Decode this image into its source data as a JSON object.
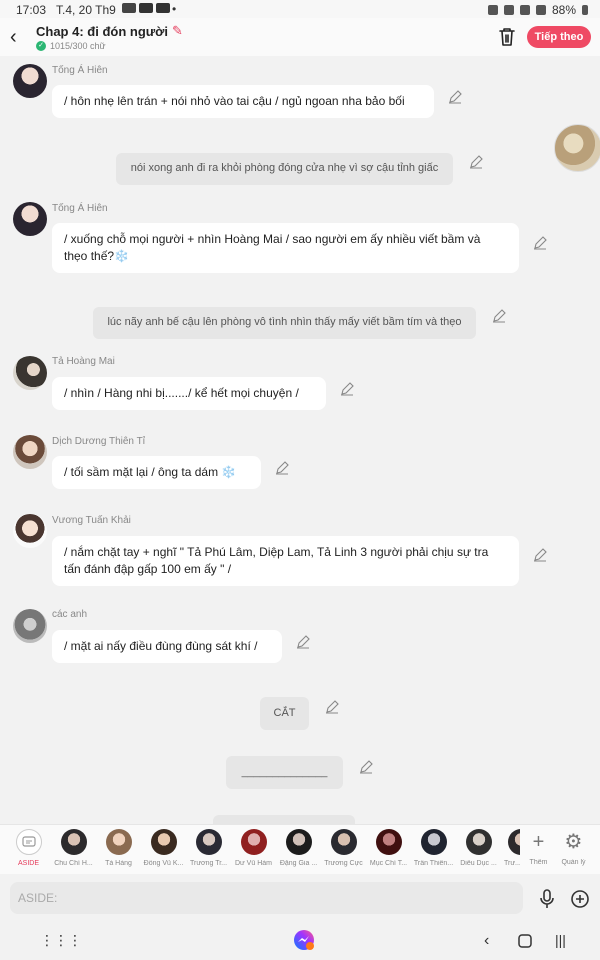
{
  "status": {
    "time": "17:03",
    "date": "T.4, 20 Th9",
    "dot": "•",
    "battery": "88%",
    "icon_names": [
      "app-icon",
      "youtube-icon",
      "youtube-icon",
      "lock-icon",
      "mute-icon",
      "wifi-icon",
      "signal-icon",
      "battery-icon"
    ]
  },
  "header": {
    "back_icon": "back-arrow-icon",
    "title": "Chap 4: đi đón người",
    "subtitle": "1015/300 chữ",
    "trash_icon": "trash-icon",
    "next_label": "Tiếp theo",
    "accent": "#ef4a64"
  },
  "messages": [
    {
      "kind": "char",
      "name": "Tống Á Hiên",
      "text": "/ hôn nhẹ lên trán + nói nhỏ vào tai cậu / ngủ ngoan nha bảo bối"
    },
    {
      "kind": "narr",
      "text": "nói xong anh đi ra khỏi phòng đóng cửa nhẹ vì sợ cậu tỉnh giấc"
    },
    {
      "kind": "char",
      "name": "Tống Á Hiên",
      "text": "/ xuống chỗ mọi người + nhìn Hoàng Mai / sao người em ấy nhiều viết bầm và thẹo thế?❄️"
    },
    {
      "kind": "narr",
      "text": "lúc nãy anh bế cậu lên phòng vô tình nhìn thấy mấy viết bầm tím và thẹo"
    },
    {
      "kind": "char",
      "name": "Tả Hoàng Mai",
      "text": "/ nhìn / Hàng nhi bị......./ kể hết mọi chuyện /"
    },
    {
      "kind": "char",
      "name": "Dịch Dương Thiên Tỉ",
      "text": "/ tối sầm mặt lại / ông ta dám ❄️"
    },
    {
      "kind": "char",
      "name": "Vương Tuấn Khải",
      "text": "/ nắm chặt tay + nghĩ \" Tả Phú Lâm, Diệp Lam, Tả Linh 3 người phải chịu sự tra tấn đánh đập gấp 100 em ấy \" /"
    },
    {
      "kind": "char",
      "name": "các anh",
      "text": "/ mặt ai nấy điều đùng đùng sát khí /"
    },
    {
      "kind": "narr",
      "text": "CẮT"
    },
    {
      "kind": "narr",
      "text": "______________"
    }
  ],
  "characters": [
    {
      "label": "ASIDE",
      "icon": "chat-bubble-icon"
    },
    {
      "label": "Chu Chí H..."
    },
    {
      "label": "Tả Hàng"
    },
    {
      "label": "Đồng Vũ K..."
    },
    {
      "label": "Trương Tr..."
    },
    {
      "label": "Dư Vũ Hàm"
    },
    {
      "label": "Đặng Gia ..."
    },
    {
      "label": "Trương Cực"
    },
    {
      "label": "Mục Chí T..."
    },
    {
      "label": "Trần Thiên..."
    },
    {
      "label": "Diêu Dục ..."
    },
    {
      "label": "Trư..."
    },
    {
      "label": "Thêm",
      "icon": "plus-icon"
    },
    {
      "label": "Quản lý",
      "icon": "gear-icon"
    }
  ],
  "input": {
    "placeholder": "ASIDE:",
    "mic_icon": "microphone-icon",
    "add_icon": "add-circle-icon"
  },
  "navbar": {
    "icons": [
      "apps-grid-icon",
      "messenger-icon",
      "back-nav-icon",
      "home-icon",
      "recents-icon"
    ]
  }
}
